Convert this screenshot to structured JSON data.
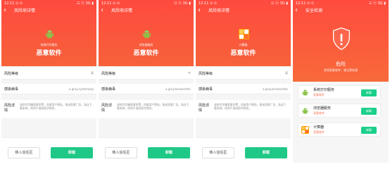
{
  "screens": [
    {
      "status_time": "12:11 ⊙ ⊙",
      "status_right": "☷ ⓝ 3G ▮",
      "title": "风险项详情",
      "app_subtitle": "系统打印服务",
      "app_title": "恶意软件",
      "risk_rank_label": "风险等级",
      "risk_rank_value": "高",
      "engine_label": "感染病毒",
      "engine_value": "a.gray.systemzap",
      "detail_label": "风险详情",
      "detail_text": "该软件涉嫌恶意扣费，窃取用户隐私，推送恶意广告，私自下载安装，给用户造成经济损失。",
      "ignore_label": "移入信任区",
      "uninstall_label": "卸载"
    },
    {
      "status_time": "12:11 ⊙ ⊙",
      "status_right": "☷ ⓝ 3G ▮",
      "title": "风险项详情",
      "app_subtitle": "浏览器服务",
      "app_title": "恶意软件",
      "risk_rank_label": "风险等级",
      "risk_rank_value": "中",
      "engine_label": "感染病毒",
      "engine_value": "a.gray.browserbtv",
      "detail_label": "风险详情",
      "detail_text": "该软件涉嫌恶意扣费，窃取用户隐私，推送恶意广告，私自下载安装，给用户造成经济损失。",
      "ignore_label": "移入信任区",
      "uninstall_label": "卸载"
    },
    {
      "status_time": "12:11 ⊙ ⊙",
      "status_right": "☷ ⓝ 3G ▮",
      "title": "风险项详情",
      "app_subtitle": "计算器",
      "app_title": "恶意软件",
      "risk_rank_label": "风险等级",
      "risk_rank_value": "高",
      "engine_label": "感染病毒",
      "engine_value": "a.gray.browserbtv",
      "detail_label": "风险详情",
      "detail_text": "该软件涉嫌恶意扣费，窃取用户隐私，推送恶意广告，私自下载安装，给用户造成经济损失。",
      "ignore_label": "移入信任区",
      "uninstall_label": "卸载"
    }
  ],
  "security": {
    "status_time": "12:11 ⊙ ⊙",
    "status_right": "☷ ⓝ 3G ▮",
    "title": "安全检测",
    "danger_title": "危险",
    "danger_subtitle": "发现恶意软件，请立即处理",
    "items": [
      {
        "name": "系统打印服务",
        "risk": "恶意软件",
        "action": "卸载"
      },
      {
        "name": "浏览器服务",
        "risk": "恶意软件",
        "action": "卸载"
      },
      {
        "name": "计算器",
        "risk": "恶意软件",
        "action": "卸载"
      }
    ]
  },
  "colors": {
    "header_red": "#ff4a3f",
    "header_orange": "#f6623a",
    "action_green": "#20c887",
    "android_green": "#8bc34a",
    "calculator_orange": "#ff9800"
  },
  "icons": [
    "back-icon",
    "android-icon",
    "calculator-icon",
    "shield-alert-icon",
    "signal-icon",
    "battery-icon"
  ]
}
